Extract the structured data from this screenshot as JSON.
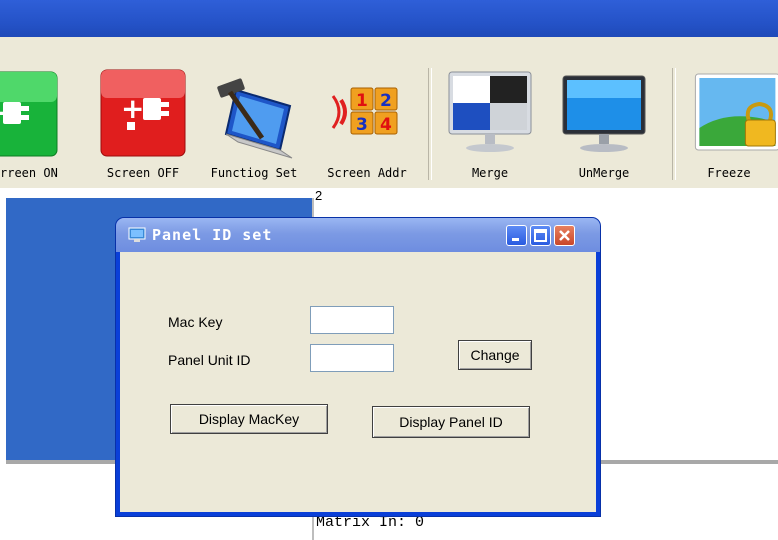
{
  "toolbar": {
    "items": [
      {
        "label": "rreen ON",
        "icon": "screen-on-icon"
      },
      {
        "label": "Screen OFF",
        "icon": "screen-off-icon"
      },
      {
        "label": "Functiog Set",
        "icon": "function-set-icon"
      },
      {
        "label": "Screen Addr",
        "icon": "screen-addr-icon"
      },
      {
        "label": "Merge",
        "icon": "merge-icon"
      },
      {
        "label": "UnMerge",
        "icon": "unmerge-icon"
      },
      {
        "label": "Freeze",
        "icon": "freeze-icon"
      }
    ]
  },
  "canvas": {
    "marker": "2",
    "matrix_status": "Matrix In: 0"
  },
  "dialog": {
    "title": "Panel ID set",
    "mac_key_label": "Mac Key",
    "mac_key_value": "",
    "panel_unit_id_label": "Panel Unit ID",
    "panel_unit_id_value": "",
    "change_label": "Change",
    "display_mackey_label": "Display MacKey",
    "display_panel_id_label": "Display Panel ID"
  },
  "addr_icon_digits": [
    "1",
    "2",
    "3",
    "4"
  ],
  "colors": {
    "titlebar": "#2553c8",
    "face": "#ece9d8",
    "workspace_blue": "#3169c6",
    "dialog_border": "#0a3fd8"
  }
}
